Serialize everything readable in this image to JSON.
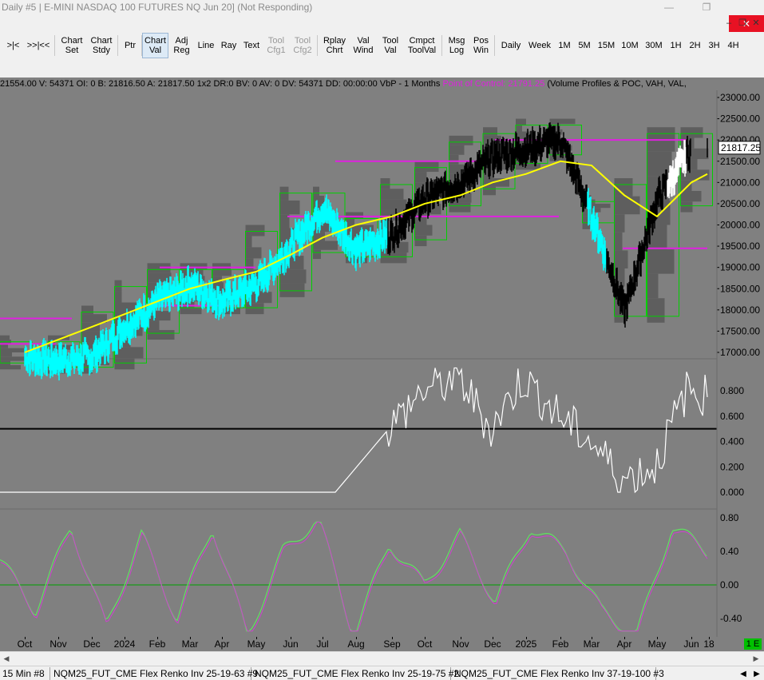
{
  "window": {
    "title": "Daily #5 | E-MINI NASDAQ 100 FUTURES NQ Jun 20] (Not Responding)",
    "minimize_icon": "minimize-icon",
    "maximize_icon": "restore-icon",
    "close_icon": "close-icon"
  },
  "toolbar": {
    "buttons": [
      {
        "label": ">|<",
        "state": "normal"
      },
      {
        "label": ">>|<<",
        "state": "normal"
      },
      {
        "label": "Chart\nSet",
        "state": "normal"
      },
      {
        "label": "Chart\nStdy",
        "state": "normal"
      },
      {
        "label": "Ptr",
        "state": "normal"
      },
      {
        "label": "Chart\nVal",
        "state": "active"
      },
      {
        "label": "Adj\nReg",
        "state": "normal"
      },
      {
        "label": "Line",
        "state": "normal"
      },
      {
        "label": "Ray",
        "state": "normal"
      },
      {
        "label": "Text",
        "state": "normal"
      },
      {
        "label": "Tool\nCfg1",
        "state": "disabled"
      },
      {
        "label": "Tool\nCfg2",
        "state": "disabled"
      },
      {
        "label": "Rplay\nChrt",
        "state": "normal"
      },
      {
        "label": "Val\nWind",
        "state": "normal"
      },
      {
        "label": "Tool\nVal",
        "state": "normal"
      },
      {
        "label": "Cmpct\nToolVal",
        "state": "normal"
      },
      {
        "label": "Msg\nLog",
        "state": "normal"
      },
      {
        "label": "Pos\nWin",
        "state": "normal"
      },
      {
        "label": "Daily",
        "state": "normal"
      },
      {
        "label": "Week",
        "state": "normal"
      },
      {
        "label": "1M",
        "state": "normal"
      },
      {
        "label": "5M",
        "state": "normal"
      },
      {
        "label": "15M",
        "state": "normal"
      },
      {
        "label": "10M",
        "state": "normal"
      },
      {
        "label": "30M",
        "state": "normal"
      },
      {
        "label": "1H",
        "state": "normal"
      },
      {
        "label": "2H",
        "state": "normal"
      },
      {
        "label": "3H",
        "state": "normal"
      },
      {
        "label": "4H",
        "state": "normal"
      }
    ]
  },
  "info": {
    "prefix": "21554.00 V: 54371 OI: 0 B: 21816.50 A: 21817.50 1x2 DR:0 BV: 0 AV: 0 DV: 54371 DD: 00:00:00 VbP - 1 Months  ",
    "poc": "Point of Control: 21791.25",
    "suffix": "  (Volume Profiles & POC, VAH, VAL,"
  },
  "price_axis": {
    "labels": [
      "23000.00",
      "22500.00",
      "22000.00",
      "21500.00",
      "21000.00",
      "20500.00",
      "20000.00",
      "19500.00",
      "19000.00",
      "18500.00",
      "18000.00",
      "17500.00",
      "17000.00"
    ],
    "last_price": "21817.25"
  },
  "osc1_axis": {
    "labels": [
      "0.800",
      "0.600",
      "0.400",
      "0.200",
      "0.000"
    ],
    "midline": 0.5
  },
  "osc2_axis": {
    "labels": [
      "0.80",
      "0.40",
      "0.00",
      "-0.40"
    ]
  },
  "date_axis": {
    "labels": [
      "Oct",
      "Nov",
      "Dec",
      "2024",
      "Feb",
      "Mar",
      "Apr",
      "May",
      "Jun",
      "Jul",
      "Aug",
      "Sep",
      "Oct",
      "Nov",
      "Dec",
      "2025",
      "Feb",
      "Mar",
      "Apr",
      "May",
      "Jun",
      "18"
    ],
    "badge": "1 E"
  },
  "tabs": [
    "15 Min  #8",
    "NQM25_FUT_CME  Flex Renko Inv 25-19-63 #9",
    "NQM25_FUT_CME  Flex Renko Inv 25-19-75 #2",
    "NQM25_FUT_CME  Flex Renko Inv 37-19-100 #3"
  ],
  "colors": {
    "chart_bg": "#808080",
    "poc_line": "#e020e0",
    "value_area_box": "#00d000",
    "moving_average": "#ffff00",
    "bars_up": "#00ffff",
    "bars_down": "#000000",
    "osc1_line": "#ffffff",
    "osc2_line_a": "#60e060",
    "osc2_line_b": "#d040d0"
  },
  "chart_data": {
    "type": "line",
    "title": "E-MINI NASDAQ 100 FUTURES NQ",
    "x": [
      "2023-10",
      "2023-11",
      "2023-12",
      "2024-01",
      "2024-02",
      "2024-03",
      "2024-04",
      "2024-05",
      "2024-06",
      "2024-07",
      "2024-08",
      "2024-09",
      "2024-10",
      "2024-11",
      "2024-12",
      "2025-01",
      "2025-02",
      "2025-03",
      "2025-04",
      "2025-05",
      "2025-06"
    ],
    "series": [
      {
        "values": [
          16900,
          16800,
          16900,
          17600,
          18200,
          18600,
          18200,
          18600,
          19500,
          20400,
          19400,
          19800,
          20600,
          21000,
          21600,
          21800,
          22000,
          20200,
          18000,
          20600,
          21800
        ]
      },
      {
        "values": [
          17000,
          17300,
          17600,
          17900,
          18200,
          18500,
          18700,
          18900,
          19300,
          19700,
          20000,
          20200,
          20500,
          20700,
          21000,
          21200,
          21500,
          21400,
          20700,
          20200,
          21000
        ]
      }
    ],
    "ylim": [
      16700,
      23200
    ],
    "poc_levels": [
      17800,
      17800,
      18000,
      19000,
      20200,
      21500,
      22000,
      19450
    ],
    "oscillator1": {
      "ylim": [
        0,
        1
      ],
      "values": [
        0,
        0,
        0,
        0,
        0,
        0,
        0,
        0,
        0,
        0,
        0,
        0.5,
        0.8,
        0.9,
        0.5,
        0.9,
        0.6,
        0.4,
        0.1,
        0.2,
        0.8,
        0.75
      ]
    },
    "oscillator2": {
      "ylim": [
        -0.6,
        0.9
      ],
      "values": [
        0.3,
        -0.3,
        0.7,
        -0.5,
        0.6,
        -0.4,
        0.7,
        -0.6,
        0.4,
        0.8,
        -0.6,
        0.5,
        0.0,
        0.6,
        -0.2,
        0.7,
        0.4,
        -0.3,
        -0.6,
        0.7,
        0.4
      ]
    }
  }
}
